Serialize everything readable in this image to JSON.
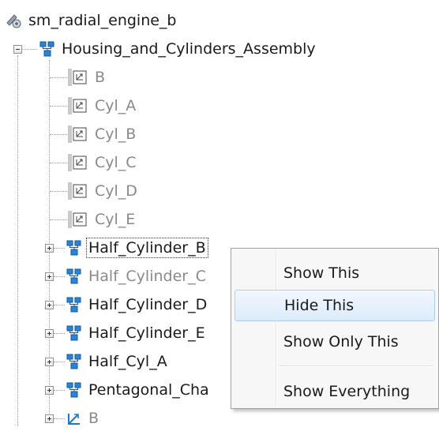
{
  "tree": {
    "root": {
      "label": "sm_radial_engine_b",
      "icon": "model-gear-icon"
    },
    "assembly": {
      "label": "Housing_and_Cylinders_Assembly",
      "icon": "subsystem-assembly-icon"
    },
    "parts": [
      {
        "label": "B",
        "icon": "part-icon"
      },
      {
        "label": "Cyl_A",
        "icon": "part-icon"
      },
      {
        "label": "Cyl_B",
        "icon": "part-icon"
      },
      {
        "label": "Cyl_C",
        "icon": "part-icon"
      },
      {
        "label": "Cyl_D",
        "icon": "part-icon"
      },
      {
        "label": "Cyl_E",
        "icon": "part-icon"
      }
    ],
    "subassemblies": [
      {
        "label": "Half_Cylinder_B",
        "state": "focused"
      },
      {
        "label": "Half_Cylinder_C",
        "state": "hidden"
      },
      {
        "label": "Half_Cylinder_D",
        "state": "normal"
      },
      {
        "label": "Half_Cylinder_E",
        "state": "normal"
      },
      {
        "label": "Half_Cyl_A",
        "state": "normal"
      },
      {
        "label": "Pentagonal_Cha",
        "state": "normal"
      }
    ],
    "frame": {
      "label": "B",
      "icon": "frame-icon"
    }
  },
  "context_menu": {
    "items": [
      {
        "label": "Show This"
      },
      {
        "label": "Hide This",
        "highlighted": true
      },
      {
        "label": "Show Only This"
      },
      {
        "label": "Show Everything"
      }
    ]
  },
  "colors": {
    "dim_text": "#8a8a8a",
    "icon_blue": "#1f78c8",
    "menu_highlight": "#dcebfc"
  }
}
